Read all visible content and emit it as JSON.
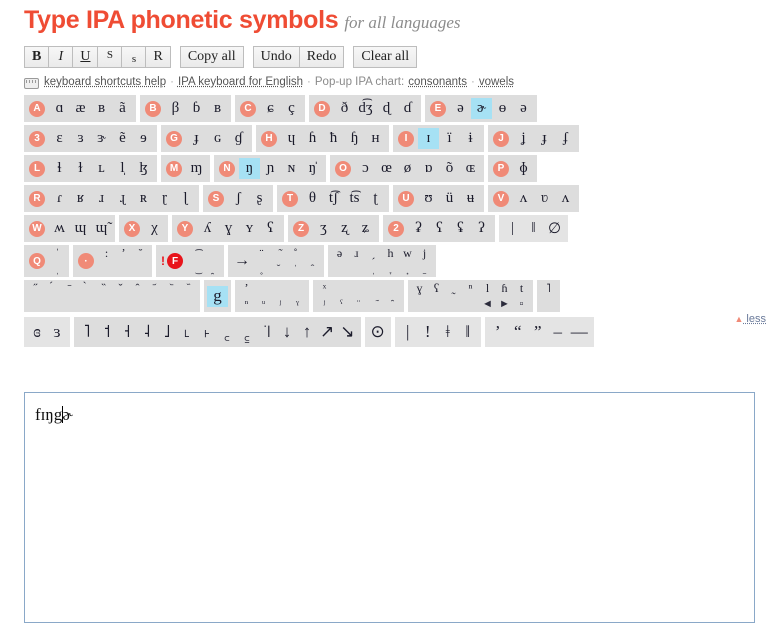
{
  "header": {
    "title": "Type IPA phonetic symbols",
    "subtitle": "for all languages"
  },
  "toolbar": {
    "bold_label": "B",
    "italic_label": "I",
    "underline_label": "U",
    "superscript_label": "S",
    "subscript_label": "s",
    "reset_label": "R",
    "copy_all_label": "Copy all",
    "undo_label": "Undo",
    "redo_label": "Redo",
    "clear_all_label": "Clear all"
  },
  "linkbar": {
    "keyboard_icon": "keyboard-icon",
    "shortcuts_help": "keyboard shortcuts help",
    "sep1": "·",
    "ipa_keyboard_english": "IPA keyboard for English",
    "sep2": "·",
    "popup_label": "Pop-up IPA chart:",
    "consonants": "consonants",
    "sep3": "·",
    "vowels": "vowels"
  },
  "less_toggle": {
    "triangle": "▲",
    "label": "less"
  },
  "keyboard": {
    "rows": [
      {
        "groups": [
          {
            "badge": "A",
            "keys": [
              "ɑ",
              "æ",
              "ʙ",
              "ã"
            ]
          },
          {
            "badge": "B",
            "keys": [
              "β",
              "ɓ",
              "ʙ"
            ]
          },
          {
            "badge": "C",
            "keys": [
              "ɕ",
              "ç"
            ]
          },
          {
            "badge": "D",
            "keys": [
              "ð",
              "d͡ʒ",
              "ɖ",
              "ɗ"
            ]
          },
          {
            "badge": "E",
            "keys": [
              "ə",
              "ɚ",
              "ɵ",
              "ə"
            ],
            "highlight": 1
          }
        ]
      },
      {
        "groups": [
          {
            "badge": "3",
            "keys": [
              "ɛ",
              "ɜ",
              "ɝ",
              "ẽ",
              "ɘ"
            ]
          },
          {
            "badge": "G",
            "keys": [
              "ɟ",
              "ɢ",
              "ɠ"
            ]
          },
          {
            "badge": "H",
            "keys": [
              "ɥ",
              "ɦ",
              "ħ",
              "ɧ",
              "ʜ"
            ]
          },
          {
            "badge": "I",
            "keys": [
              "ɪ",
              "ï",
              "ɨ"
            ],
            "highlight": 0
          },
          {
            "badge": "J",
            "keys": [
              "ʝ",
              "ɟ",
              "ʄ"
            ]
          }
        ]
      },
      {
        "groups": [
          {
            "badge": "L",
            "keys": [
              "ɬ",
              "ɫ",
              "ʟ",
              "l̩",
              "ɮ"
            ]
          },
          {
            "badge": "M",
            "keys": [
              "ɱ"
            ]
          },
          {
            "badge": "N",
            "keys": [
              "ŋ",
              "ɲ",
              "ɴ",
              "ŋ̍"
            ],
            "highlight": 0
          },
          {
            "badge": "O",
            "keys": [
              "ɔ",
              "œ",
              "ø",
              "ɒ",
              "õ",
              "ɶ"
            ]
          },
          {
            "badge": "P",
            "keys": [
              "ɸ"
            ]
          }
        ]
      },
      {
        "groups": [
          {
            "badge": "R",
            "keys": [
              "ɾ",
              "ʁ",
              "ɹ",
              "ɻ",
              "ʀ",
              "ɽ",
              "ɭ"
            ]
          },
          {
            "badge": "S",
            "keys": [
              "ʃ",
              "ʂ"
            ]
          },
          {
            "badge": "T",
            "keys": [
              "θ",
              "t͡ʃ",
              "t͡s",
              "ʈ"
            ]
          },
          {
            "badge": "U",
            "keys": [
              "ʊ",
              "ü",
              "ʉ"
            ]
          },
          {
            "badge": "V",
            "keys": [
              "ʌ",
              "ʋ",
              "ʌ"
            ]
          }
        ]
      },
      {
        "groups": [
          {
            "badge": "W",
            "keys": [
              "ʍ",
              "ɰ",
              "ɰ̃"
            ]
          },
          {
            "badge": "X",
            "keys": [
              "χ"
            ]
          },
          {
            "badge": "Y",
            "keys": [
              "ʎ",
              "ɣ",
              "ʏ",
              "ʕ"
            ]
          },
          {
            "badge": "Z",
            "keys": [
              "ʒ",
              "ʐ",
              "ʑ"
            ]
          },
          {
            "badge": "2",
            "keys": [
              "ʡ",
              "ʕ",
              "ʢ",
              "ʔ"
            ]
          },
          {
            "badge": "",
            "keys": [
              "|",
              "‖",
              "∅"
            ]
          }
        ]
      }
    ],
    "diacritic_row_1": {
      "groups": [
        {
          "badge": "Q",
          "upper": [
            "ˈ"
          ],
          "lower": [
            "ˌ"
          ]
        },
        {
          "badge": "dot",
          "upper": [
            ":",
            "ʼ",
            "̆"
          ],
          "lower": []
        },
        {
          "badge": "F",
          "bang": "!",
          "upper": [
            "͡"
          ],
          "lower": [
            "͜",
            "̯"
          ]
        },
        {
          "badge": "",
          "arrow": "→",
          "upper": [
            "̈",
            "̃",
            "̊"
          ],
          "lower": [
            "̥",
            "̌",
            "̍",
            "̂"
          ]
        },
        {
          "badge": "",
          "upper": [
            "ə",
            "ɹ",
            "̗",
            "h",
            "w",
            "j"
          ],
          "lower": [
            "̩",
            "̞",
            "̟",
            "̠"
          ]
        }
      ]
    },
    "diacritic_row_2": {
      "groups": [
        {
          "upper": [
            "̋",
            "́",
            "̄",
            "̀",
            "̏",
            "̌",
            "̂",
            "᷄",
            "᷅",
            "᷈"
          ],
          "lower": []
        },
        {
          "keys": [
            "g"
          ],
          "highlight": 0
        },
        {
          "upper": [
            "ʼ"
          ],
          "lower": [
            "ⁿ",
            "ᵘ",
            "ʲ",
            "ˠ"
          ]
        },
        {
          "upper": [
            "ˣ"
          ],
          "lower": [
            "ʲ",
            "ˤ",
            "̈",
            "̃",
            "̑"
          ]
        },
        {
          "upper": [
            "ɣ",
            "ʕ",
            "̰",
            "ⁿ",
            "l",
            "ɦ",
            "t"
          ],
          "lower": [
            "◄",
            "►",
            "▫"
          ]
        },
        {
          "upper": [
            "˥"
          ],
          "lower": []
        }
      ]
    },
    "tone_row": {
      "groups": [
        {
          "keys": [
            "ɞ",
            "ɜ"
          ]
        },
        {
          "keys": [
            "˥",
            "˦",
            "˧",
            "˨",
            "˩",
            "˪",
            "˫",
            "꜀",
            "꜁",
            "꜈",
            "↓",
            "↑",
            "↗",
            "↘"
          ]
        },
        {
          "keys": [
            "⊙"
          ]
        },
        {
          "keys": [
            "|",
            "!",
            "ǂ",
            "‖"
          ]
        },
        {
          "keys": [
            "’",
            "“",
            "”",
            "–",
            "—"
          ]
        }
      ]
    }
  },
  "editor": {
    "text_before_caret": "fɪŋg",
    "text_after_caret": "ɚ"
  }
}
